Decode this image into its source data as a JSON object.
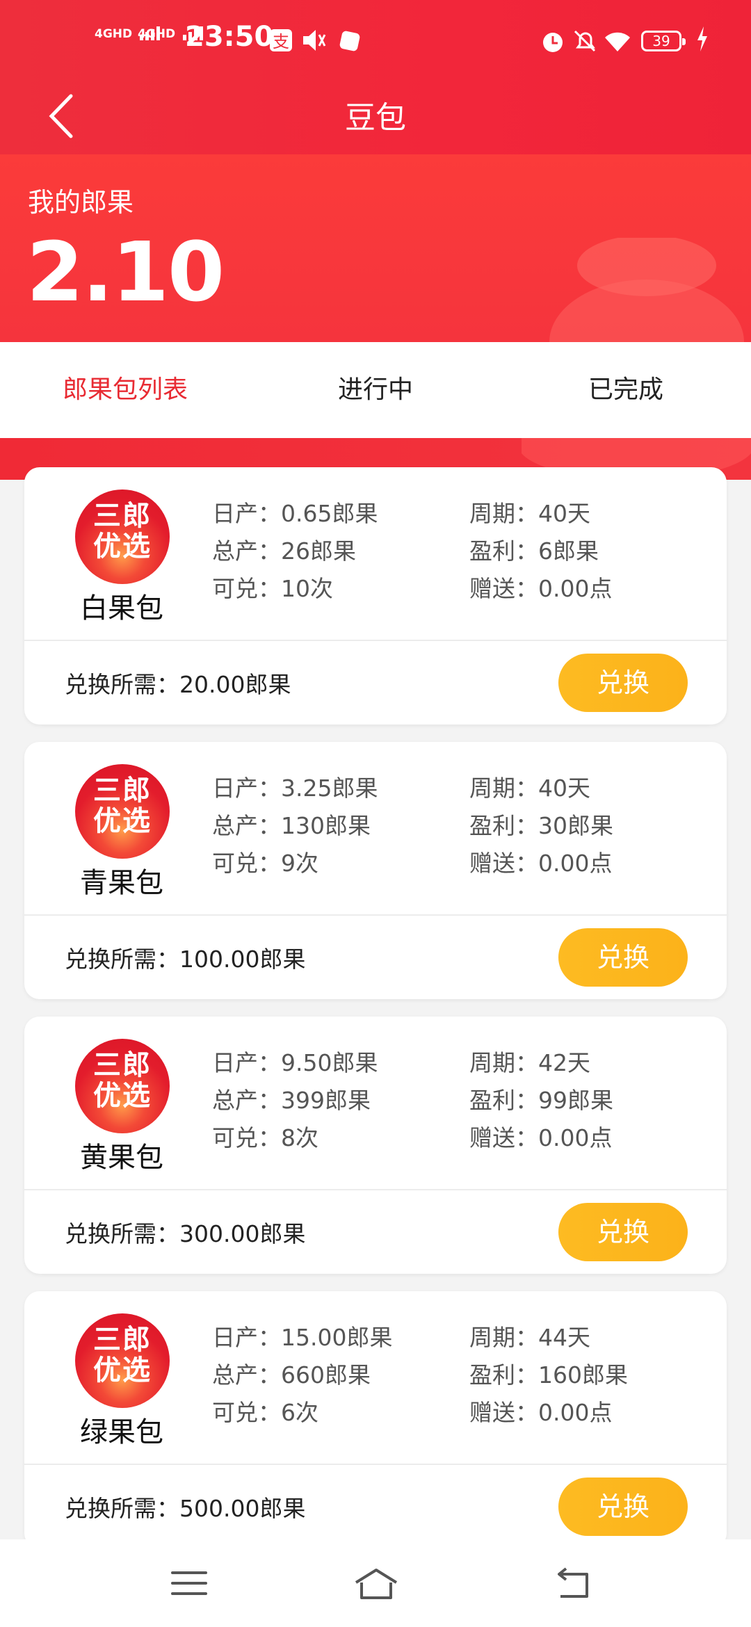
{
  "status_bar": {
    "network1": "4GHD",
    "network2": "4GHD",
    "time": "23:50",
    "battery": "39"
  },
  "header": {
    "title": "豆包"
  },
  "balance": {
    "label": "我的郎果",
    "value": "2.10"
  },
  "tabs": [
    {
      "label": "郎果包列表",
      "active": true
    },
    {
      "label": "进行中",
      "active": false
    },
    {
      "label": "已完成",
      "active": false
    }
  ],
  "logo_text": {
    "line1": "三郎",
    "line2": "优选"
  },
  "cards": [
    {
      "name": "白果包",
      "daily": "日产：0.65郎果",
      "cycle": "周期：40天",
      "total": "总产：26郎果",
      "profit": "盈利：6郎果",
      "redeem": "可兑：10次",
      "gift": "赠送：0.00点",
      "price": "兑换所需：20.00郎果",
      "button": "兑换"
    },
    {
      "name": "青果包",
      "daily": "日产：3.25郎果",
      "cycle": "周期：40天",
      "total": "总产：130郎果",
      "profit": "盈利：30郎果",
      "redeem": "可兑：9次",
      "gift": "赠送：0.00点",
      "price": "兑换所需：100.00郎果",
      "button": "兑换"
    },
    {
      "name": "黄果包",
      "daily": "日产：9.50郎果",
      "cycle": "周期：42天",
      "total": "总产：399郎果",
      "profit": "盈利：99郎果",
      "redeem": "可兑：8次",
      "gift": "赠送：0.00点",
      "price": "兑换所需：300.00郎果",
      "button": "兑换"
    },
    {
      "name": "绿果包",
      "daily": "日产：15.00郎果",
      "cycle": "周期：44天",
      "total": "总产：660郎果",
      "profit": "盈利：160郎果",
      "redeem": "可兑：6次",
      "gift": "赠送：0.00点",
      "price": "兑换所需：500.00郎果",
      "button": "兑换"
    }
  ],
  "colors": {
    "header_red": "#ee2e3c",
    "active_tab": "#e82b33",
    "button_yellow": "#fdbb22"
  },
  "icons": [
    "back-arrow-icon",
    "alarm-icon",
    "mute-icon",
    "wifi-icon",
    "charging-icon",
    "menu-icon",
    "home-icon",
    "return-icon"
  ]
}
